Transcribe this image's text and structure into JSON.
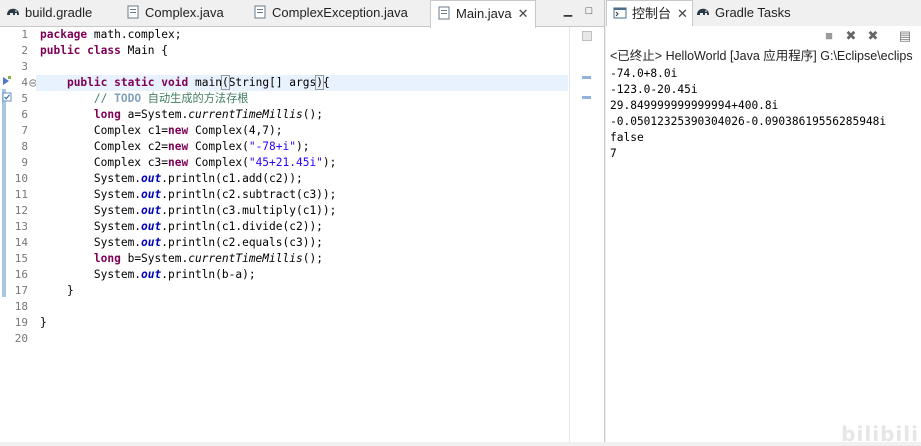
{
  "editor": {
    "tabs": [
      {
        "label": "build.gradle",
        "icon": "gradle-elephant-icon"
      },
      {
        "label": "Complex.java",
        "icon": "java-file-icon"
      },
      {
        "label": "ComplexException.java",
        "icon": "java-file-icon"
      },
      {
        "label": "Main.java",
        "icon": "java-file-icon",
        "active": true,
        "close": "✕"
      }
    ],
    "line_numbers": [
      "1",
      "2",
      "3",
      "4",
      "5",
      "6",
      "7",
      "8",
      "9",
      "10",
      "11",
      "12",
      "13",
      "14",
      "15",
      "16",
      "17",
      "18",
      "19",
      "20"
    ],
    "code": {
      "l1": {
        "kw": "package",
        "rest": " math.complex;"
      },
      "l2": {
        "kw1": "public",
        "kw2": "class",
        "rest": " Main {"
      },
      "l4": {
        "kw1": "public",
        "kw2": "static",
        "kw3": "void",
        "name": " main",
        "paren": "(",
        "type": "String[] args",
        "close": ")",
        "brace": "{"
      },
      "l5": {
        "prefix": "// ",
        "todo": "TODO",
        "text": " 自动生成的方法存根"
      },
      "l6": {
        "kw": "long",
        "a": " a=System.",
        "m": "currentTimeMillis",
        "b": "();"
      },
      "l7": {
        "a": "Complex c1=",
        "kw": "new",
        "b": " Complex(4,7);"
      },
      "l8": {
        "a": "Complex c2=",
        "kw": "new",
        "b": " Complex(",
        "s": "\"-78+i\"",
        "c": ");"
      },
      "l9": {
        "a": "Complex c3=",
        "kw": "new",
        "b": " Complex(",
        "s": "\"45+21.45i\"",
        "c": ");"
      },
      "l10": {
        "a": "System.",
        "f": "out",
        "b": ".println(c1.add(c2));"
      },
      "l11": {
        "a": "System.",
        "f": "out",
        "b": ".println(c2.subtract(c3));"
      },
      "l12": {
        "a": "System.",
        "f": "out",
        "b": ".println(c3.multiply(c1));"
      },
      "l13": {
        "a": "System.",
        "f": "out",
        "b": ".println(c1.divide(c2));"
      },
      "l14": {
        "a": "System.",
        "f": "out",
        "b": ".println(c2.equals(c3));"
      },
      "l15": {
        "kw": "long",
        "a": " b=System.",
        "m": "currentTimeMillis",
        "b": "();"
      },
      "l16": {
        "a": "System.",
        "f": "out",
        "b": ".println(b-a);"
      },
      "l17": {
        "text": "}"
      },
      "l19": {
        "text": "}"
      }
    }
  },
  "console": {
    "tabs": [
      {
        "label": "控制台",
        "icon": "console-icon",
        "close": "✕"
      },
      {
        "label": "Gradle Tasks",
        "icon": "gradle-elephant-icon"
      }
    ],
    "status": "<已终止> HelloWorld [Java 应用程序] G:\\Eclipse\\eclips",
    "output": [
      "-74.0+8.0i",
      "-123.0-20.45i",
      "29.849999999999994+400.8i",
      "-0.05012325390304026-0.09038619556285948i",
      "false",
      "7"
    ]
  },
  "watermark": "bilibili",
  "colors": {
    "keyword": "#7f0055",
    "string": "#2a00ff",
    "comment": "#3f7f5f",
    "field": "#0000c0",
    "current_line": "#e8f2fe"
  }
}
